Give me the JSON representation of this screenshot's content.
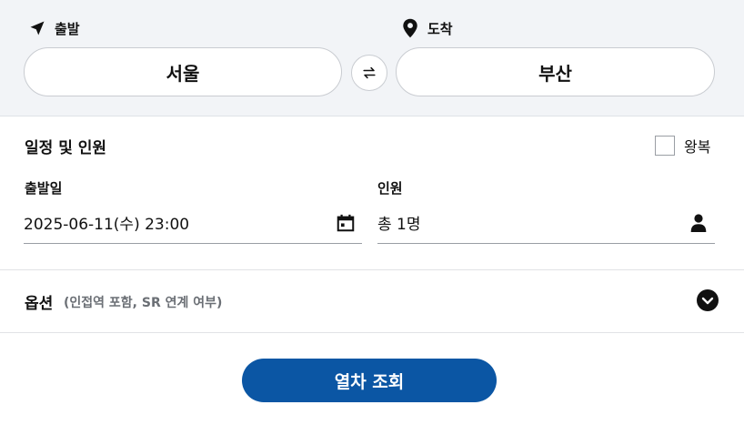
{
  "route": {
    "departure_label": "출발",
    "arrival_label": "도착",
    "departure_station": "서울",
    "arrival_station": "부산",
    "icons": {
      "departure": "send-arrow-icon",
      "arrival": "map-pin-icon",
      "swap": "swap-icon"
    }
  },
  "schedule": {
    "title": "일정 및 인원",
    "roundtrip_label": "왕복",
    "roundtrip_checked": false,
    "date_label": "출발일",
    "date_value": "2025-06-11(수) 23:00",
    "passenger_label": "인원",
    "passenger_value": "총 1명",
    "icons": {
      "date": "calendar-icon",
      "passenger": "person-icon"
    }
  },
  "options": {
    "title": "옵션",
    "subtitle": "(인접역 포함, SR 연계 여부)",
    "icon": "chevron-down-circle-icon"
  },
  "search_button": {
    "label": "열차 조회"
  },
  "colors": {
    "accent": "#0b56a4",
    "panel": "#f2f4f7",
    "text": "#111111",
    "muted": "#6b6f75"
  }
}
